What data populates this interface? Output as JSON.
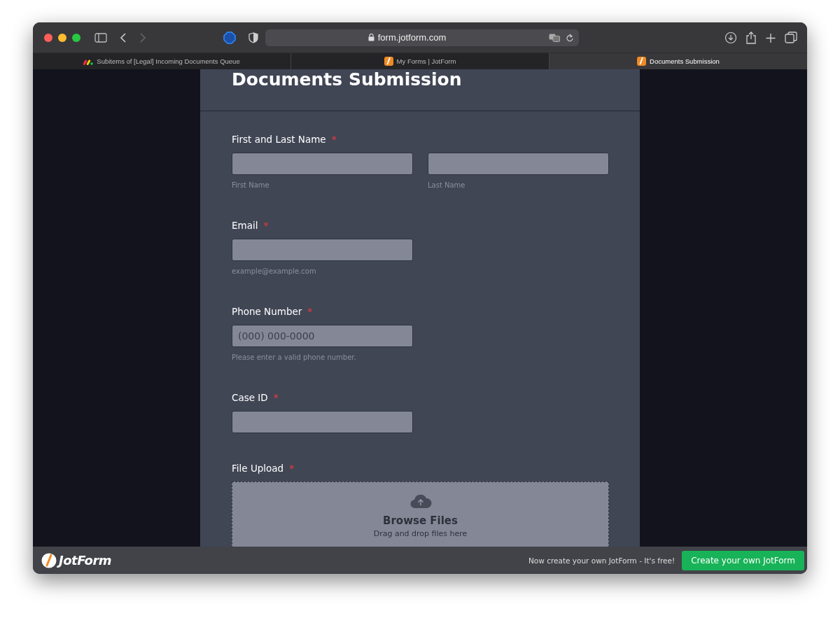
{
  "browser": {
    "url": "form.jotform.com"
  },
  "tabs": [
    {
      "title": "Subitems of [Legal] Incoming Documents Queue",
      "kind": "monday",
      "selected": false
    },
    {
      "title": "My Forms | JotForm",
      "kind": "jotform",
      "selected": false
    },
    {
      "title": "Documents Submission",
      "kind": "jotform",
      "selected": true
    }
  ],
  "form": {
    "title": "Documents Submission",
    "fields": [
      {
        "kind": "name",
        "label": "First and Last Name",
        "required_mark": "*",
        "inputs": [
          {
            "sublabel": "First Name"
          },
          {
            "sublabel": "Last Name"
          }
        ]
      },
      {
        "kind": "text",
        "label": "Email",
        "required_mark": "*",
        "sublabel": "example@example.com"
      },
      {
        "kind": "text",
        "label": "Phone Number",
        "required_mark": "*",
        "placeholder": "(000) 000-0000",
        "sublabel": "Please enter a valid phone number."
      },
      {
        "kind": "text",
        "label": "Case ID",
        "required_mark": "*"
      },
      {
        "kind": "upload",
        "label": "File Upload",
        "required_mark": "*",
        "button": "Browse Files",
        "hint": "Drag and drop files here"
      }
    ]
  },
  "footer": {
    "brand": "JotForm",
    "note": "Now create your own JotForm - It's free!",
    "button": "Create your own JotForm"
  }
}
